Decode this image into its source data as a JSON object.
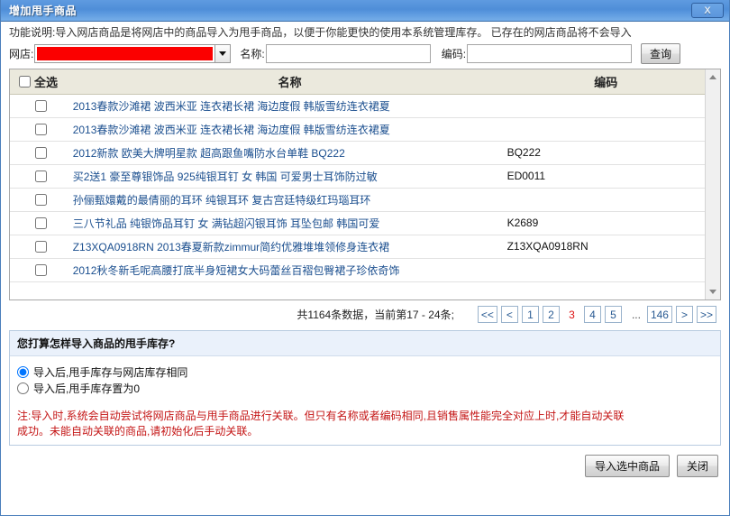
{
  "window": {
    "title": "增加甩手商品",
    "close_label": "X"
  },
  "description": "功能说明:导入网店商品是将网店中的商品导入为甩手商品，以便于你能更快的使用本系统管理库存。 已存在的网店商品将不会导入",
  "search": {
    "shop_label": "网店:",
    "shop_value": "",
    "name_label": "名称:",
    "name_value": "",
    "code_label": "编码:",
    "code_value": "",
    "query_button": "查询"
  },
  "table": {
    "headers": {
      "select_all": "全选",
      "name": "名称",
      "code": "编码"
    },
    "rows": [
      {
        "name": "2013春款沙滩裙 波西米亚 连衣裙长裙 海边度假 韩版雪纺连衣裙夏",
        "code": "",
        "checked": false
      },
      {
        "name": "2013春款沙滩裙 波西米亚 连衣裙长裙 海边度假 韩版雪纺连衣裙夏",
        "code": "",
        "checked": false
      },
      {
        "name": "2012新款 欧美大牌明星款 超高跟鱼嘴防水台单鞋 BQ222",
        "code": "BQ222",
        "checked": false
      },
      {
        "name": "买2送1 豪至尊银饰品 925纯银耳钉 女 韩国 可爱男士耳饰防过敏",
        "code": "ED0011",
        "checked": false
      },
      {
        "name": "孙俪甄嬛戴的最倩丽的耳环 纯银耳环 复古宫廷特级红玛瑙耳环",
        "code": "",
        "checked": false
      },
      {
        "name": "三八节礼品 纯银饰品耳钉 女 满钻超闪银耳饰 耳坠包邮 韩国可爱",
        "code": "K2689",
        "checked": false
      },
      {
        "name": "Z13XQA0918RN 2013春夏新款zimmur简约优雅堆堆领修身连衣裙",
        "code": "Z13XQA0918RN",
        "checked": false
      },
      {
        "name": "2012秋冬新毛呢高腰打底半身短裙女大码蕾丝百褶包臀裙子珍依奇饰",
        "code": "",
        "checked": false
      }
    ]
  },
  "pagination": {
    "summary": "共1164条数据，当前第17 - 24条;",
    "first": "<<",
    "prev": "<",
    "pages": [
      "1",
      "2",
      "3",
      "4",
      "5"
    ],
    "ellipsis": "...",
    "last_page": "146",
    "next": ">",
    "last": ">>",
    "current_page": "3",
    "current_color": "#dd1111"
  },
  "options": {
    "heading": "您打算怎样导入商品的甩手库存?",
    "radio1": "导入后,甩手库存与网店库存相同",
    "radio2": "导入后,甩手库存置为0",
    "selected": "radio1"
  },
  "note": {
    "line1": "注:导入时,系统会自动尝试将网店商品与甩手商品进行关联。但只有名称或者编码相同,且销售属性能完全对应上时,才能自动关联",
    "line2": "成功。未能自动关联的商品,请初始化后手动关联。",
    "color": "#c41515"
  },
  "footer": {
    "import_button": "导入选中商品",
    "close_button": "关闭"
  }
}
